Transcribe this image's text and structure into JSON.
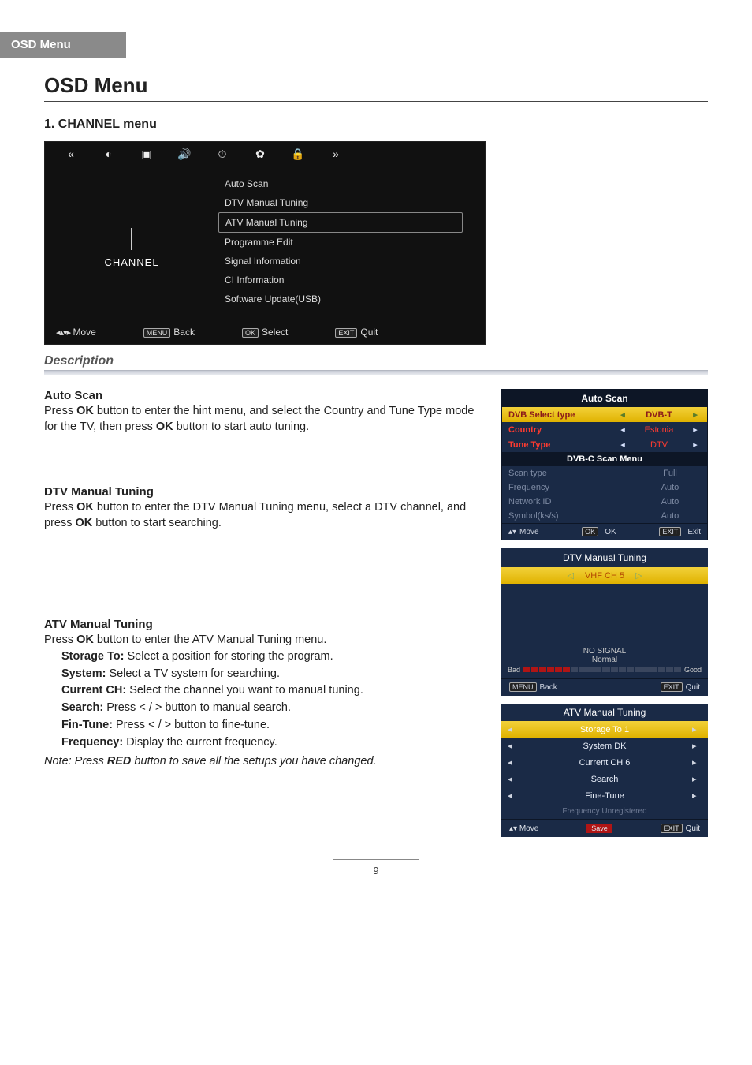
{
  "header_tab": "OSD Menu",
  "title": "OSD Menu",
  "section1": "1. CHANNEL menu",
  "channel_menu": {
    "side_label": "CHANNEL",
    "items": [
      "Auto Scan",
      "DTV Manual Tuning",
      "ATV Manual Tuning",
      "Programme Edit",
      "Signal Information",
      "CI Information",
      "Software Update(USB)"
    ],
    "selected_index": 2,
    "footer": {
      "move": "Move",
      "back": "Back",
      "select": "Select",
      "quit": "Quit",
      "back_key": "MENU",
      "select_key": "OK",
      "quit_key": "EXIT"
    }
  },
  "description_label": "Description",
  "auto_scan": {
    "heading": "Auto Scan",
    "body_pre": "Press ",
    "ok1": "OK",
    "body_mid": " button to enter the hint menu, and select the Country and Tune Type mode for the TV, then press ",
    "ok2": "OK",
    "body_post": " button to start auto tuning."
  },
  "auto_scan_panel": {
    "title": "Auto Scan",
    "rows": [
      {
        "k": "DVB Select type",
        "v": "DVB-T",
        "hl": true
      },
      {
        "k": "Country",
        "v": "Estonia",
        "red": true
      },
      {
        "k": "Tune Type",
        "v": "DTV",
        "red": true
      }
    ],
    "sub": "DVB-C Scan Menu",
    "dims": [
      {
        "k": "Scan type",
        "v": "Full"
      },
      {
        "k": "Frequency",
        "v": "Auto"
      },
      {
        "k": "Network ID",
        "v": "Auto"
      },
      {
        "k": "Symbol(ks/s)",
        "v": "Auto"
      }
    ],
    "foot": {
      "move": "Move",
      "ok": "OK",
      "ok_key": "OK",
      "exit": "Exit",
      "exit_key": "EXIT"
    }
  },
  "dtv": {
    "heading": "DTV Manual Tuning",
    "body_pre": "Press ",
    "ok1": "OK",
    "body_mid": " button to enter the DTV Manual Tuning menu, select a DTV channel, and press ",
    "ok2": "OK",
    "body_post": " button to start searching."
  },
  "dtv_panel": {
    "title": "DTV Manual Tuning",
    "channel": "VHF CH 5",
    "signal_label": "NO SIGNAL",
    "signal_sub": "Normal",
    "bad": "Bad",
    "good": "Good",
    "foot": {
      "back": "Back",
      "back_key": "MENU",
      "quit": "Quit",
      "quit_key": "EXIT"
    }
  },
  "atv": {
    "heading": "ATV Manual Tuning",
    "intro_pre": "Press ",
    "intro_ok": "OK",
    "intro_post": " button to enter the ATV Manual Tuning menu.",
    "defs": [
      {
        "k": "Storage To:",
        "v": " Select a position for storing the program."
      },
      {
        "k": "System:",
        "v": " Select a TV system for searching."
      },
      {
        "k": "Current CH:",
        "v": " Select the channel you want to manual tuning."
      },
      {
        "k": "Search:",
        "v": " Press < / > button to manual search."
      },
      {
        "k": "Fin-Tune:",
        "v": " Press < / > button to fine-tune."
      },
      {
        "k": "Frequency:",
        "v": " Display the current frequency."
      }
    ],
    "note_pre": "Note: Press ",
    "note_red": "RED",
    "note_post": " button to save all the setups you have changed."
  },
  "atv_panel": {
    "title": "ATV Manual Tuning",
    "lines": [
      {
        "text": "Storage To  1",
        "hl": true
      },
      {
        "text": "System  DK"
      },
      {
        "text": "Current CH  6"
      },
      {
        "text": "Search"
      },
      {
        "text": "Fine-Tune"
      }
    ],
    "freq": "Frequency Unregistered",
    "foot": {
      "move": "Move",
      "save": "Save",
      "quit": "Quit",
      "quit_key": "EXIT"
    }
  },
  "page_number": "9"
}
